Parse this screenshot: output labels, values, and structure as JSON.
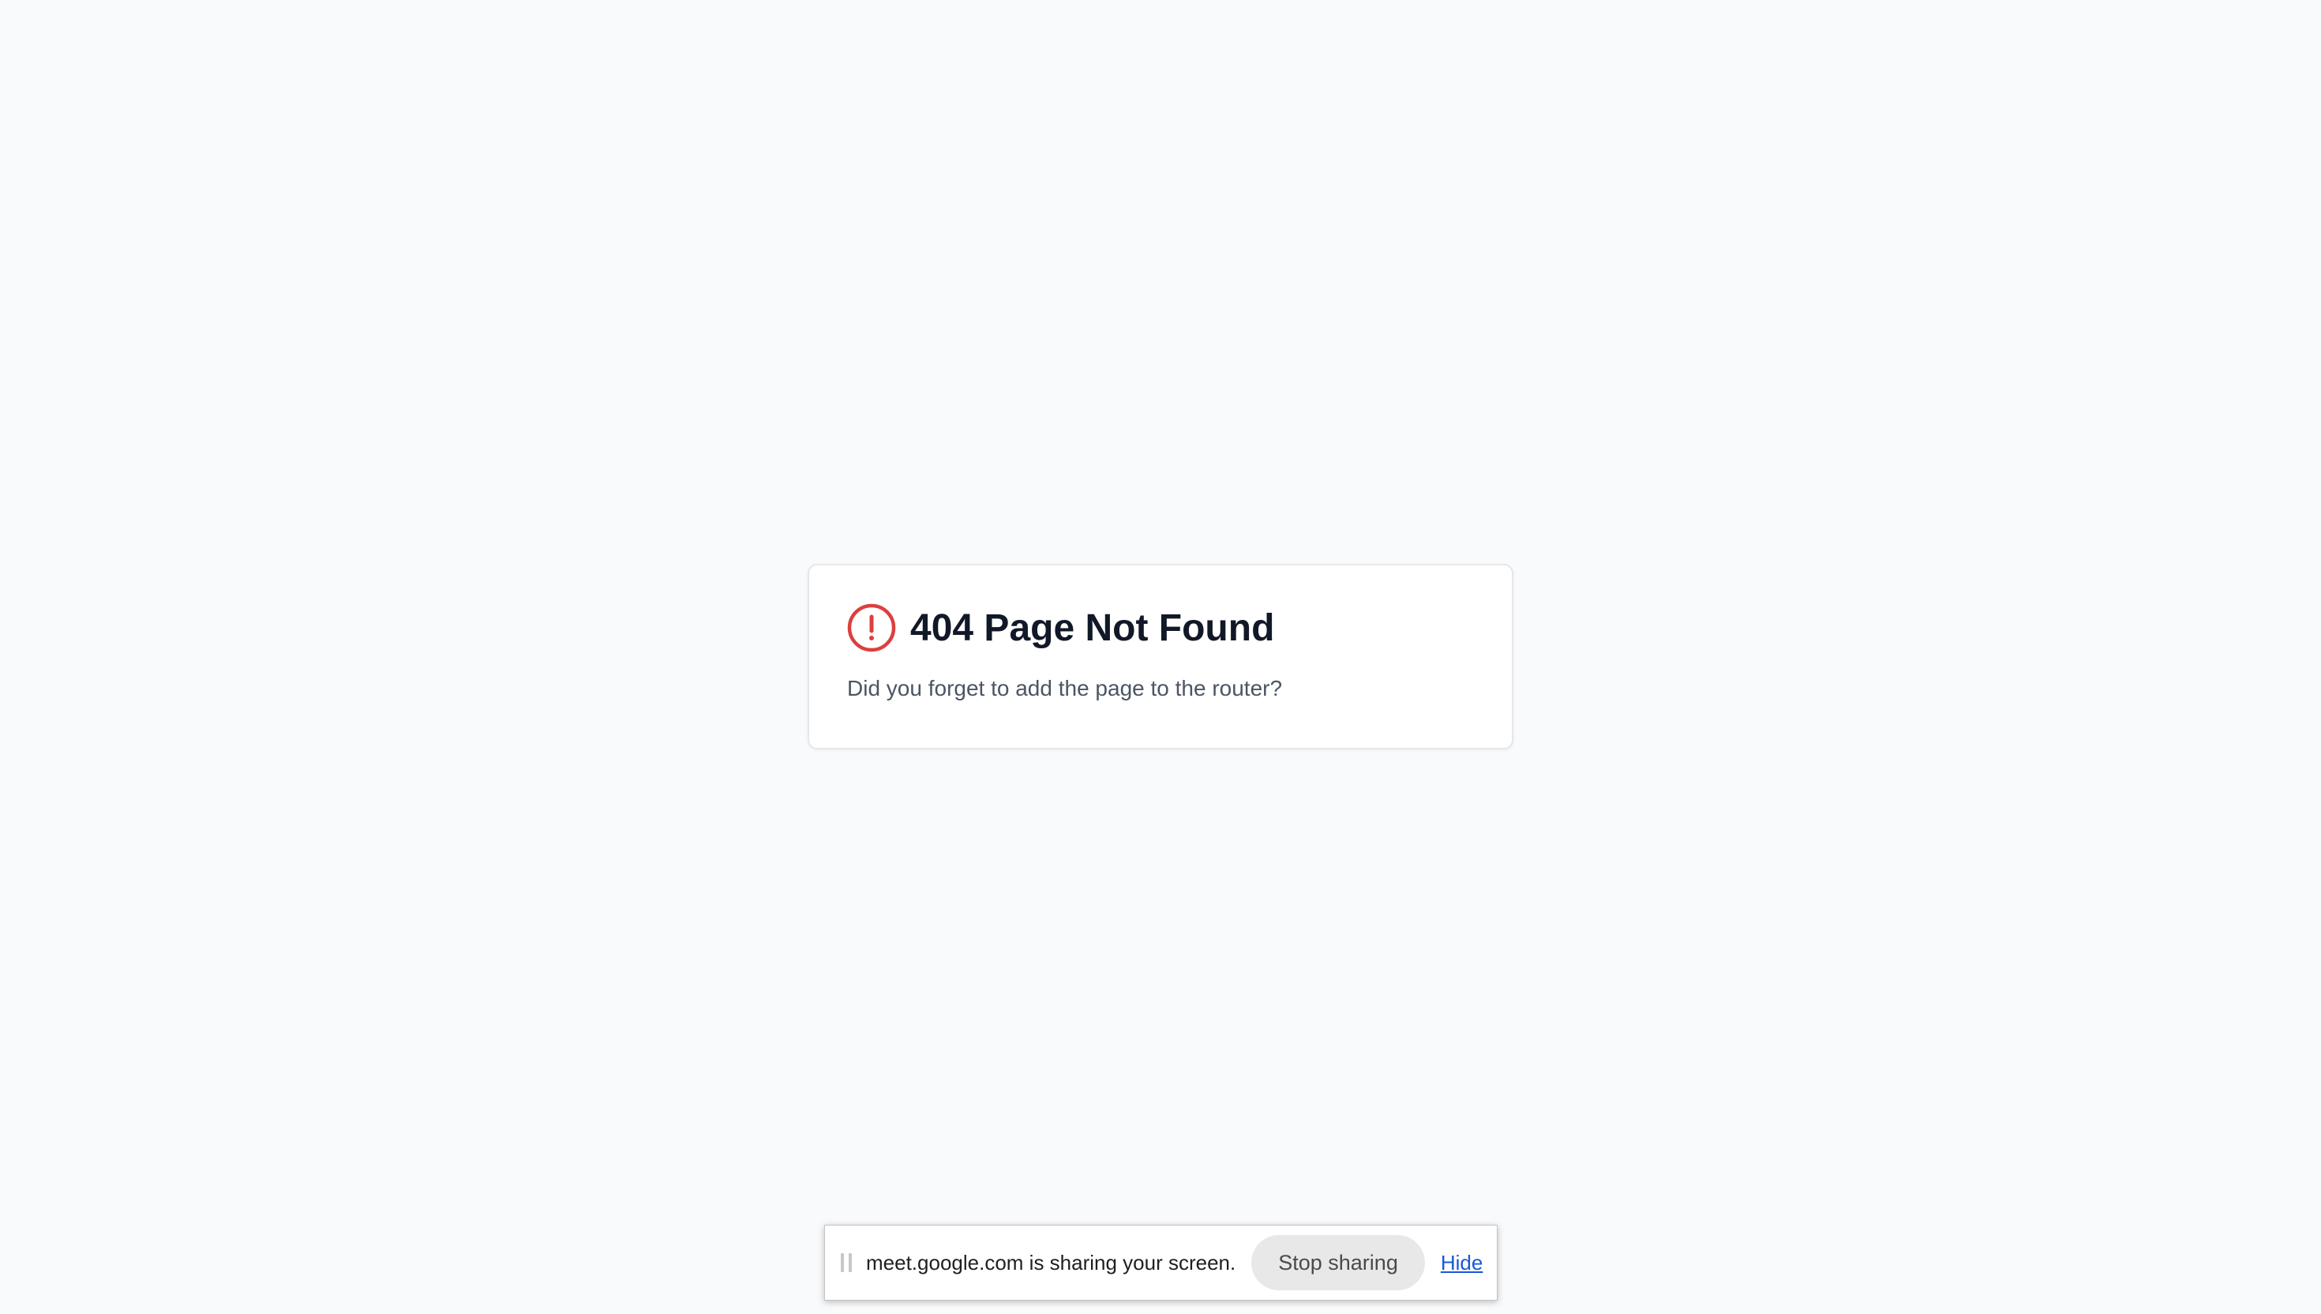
{
  "card": {
    "title": "404 Page Not Found",
    "message": "Did you forget to add the page to the router?",
    "icon": "alert-circle-icon",
    "icon_color": "#dc3f3f"
  },
  "share_bar": {
    "message": "meet.google.com is sharing your screen.",
    "stop_label": "Stop sharing",
    "hide_label": "Hide",
    "link_color": "#1a56db"
  },
  "colors": {
    "background": "#f9fafb",
    "card_background": "#ffffff",
    "title": "#111827",
    "message": "#4b5563"
  }
}
